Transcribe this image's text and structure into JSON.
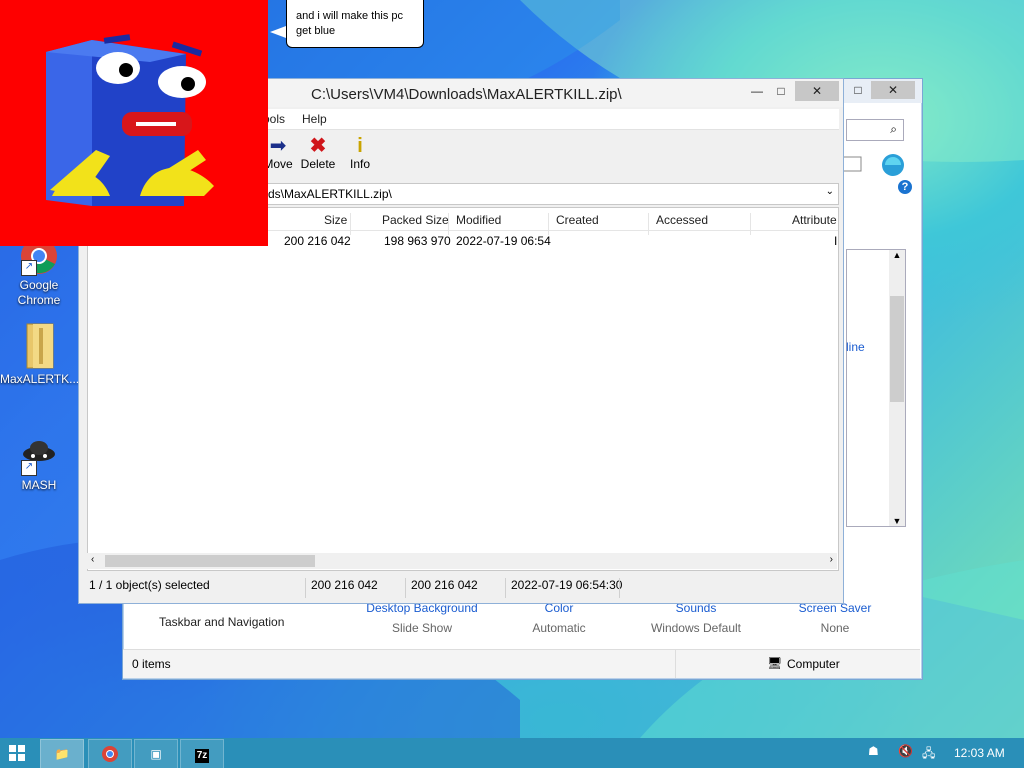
{
  "desktop": {
    "icons": [
      {
        "label1": "Google",
        "label2": "Chrome",
        "icon": "chrome-icon"
      },
      {
        "label1": "MaxALERTK...",
        "label2": "",
        "icon": "folder-icon"
      },
      {
        "label1": "MASH",
        "label2": "",
        "icon": "mash-icon"
      }
    ]
  },
  "speech": {
    "text1": "and i will make this pc",
    "text2": "get blue"
  },
  "zip": {
    "title": "C:\\Users\\VM4\\Downloads\\MaxALERTKILL.zip\\",
    "menu": {
      "tools": "ools",
      "help": "Help"
    },
    "toolbar": {
      "move": "Move",
      "delete": "Delete",
      "info": "Info"
    },
    "address": "ds\\MaxALERTKILL.zip\\",
    "columns": {
      "size": "Size",
      "packed": "Packed Size",
      "modified": "Modified",
      "created": "Created",
      "accessed": "Accessed",
      "attributes": "Attribute"
    },
    "row": {
      "size": "200 216 042",
      "packed": "198 963 970",
      "modified": "2022-07-19 06:54",
      "attr": "I"
    },
    "status": {
      "selected": "1 / 1 object(s) selected",
      "size": "200 216 042",
      "size2": "200 216 042",
      "date": "2022-07-19 06:54:30"
    }
  },
  "controlpanel": {
    "online_link": "line",
    "taskbar_nav": "Taskbar and Navigation",
    "items": [
      {
        "link": "Desktop Background",
        "sub": "Slide Show"
      },
      {
        "link": "Color",
        "sub": "Automatic"
      },
      {
        "link": "Sounds",
        "sub": "Windows Default"
      },
      {
        "link": "Screen Saver",
        "sub": "None"
      }
    ],
    "status_items": "0 items",
    "status_computer": "Computer"
  },
  "taskbar": {
    "clock": "12:03 AM"
  },
  "colors": {
    "mascot_bg": "#fe0000",
    "taskbar": "#2a8fb8",
    "link": "#1a5cd0"
  }
}
